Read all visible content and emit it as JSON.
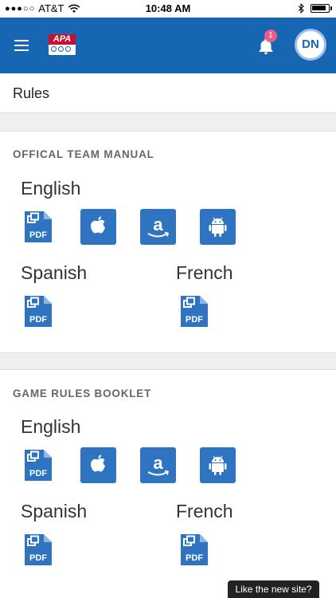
{
  "status_bar": {
    "carrier": "AT&T",
    "time": "10:48 AM",
    "signal_dots": "●●●○○",
    "battery_level": 0.9
  },
  "header": {
    "logo_text": "APA",
    "notification_count": "1",
    "avatar_initials": "DN"
  },
  "page": {
    "title": "Rules"
  },
  "sections": [
    {
      "heading": "OFFICAL TEAM MANUAL",
      "english_label": "English",
      "spanish_label": "Spanish",
      "french_label": "French",
      "formats": [
        "PDF",
        "Apple",
        "Amazon",
        "Android"
      ]
    },
    {
      "heading": "GAME RULES BOOKLET",
      "english_label": "English",
      "spanish_label": "Spanish",
      "french_label": "French",
      "formats": [
        "PDF",
        "Apple",
        "Amazon",
        "Android"
      ]
    }
  ],
  "pdf_icon_text": "PDF",
  "toast": {
    "text": "Like the new site?"
  },
  "colors": {
    "brand_blue": "#1766b3",
    "icon_blue": "#2f74c1",
    "badge_pink": "#ec5b8a"
  }
}
